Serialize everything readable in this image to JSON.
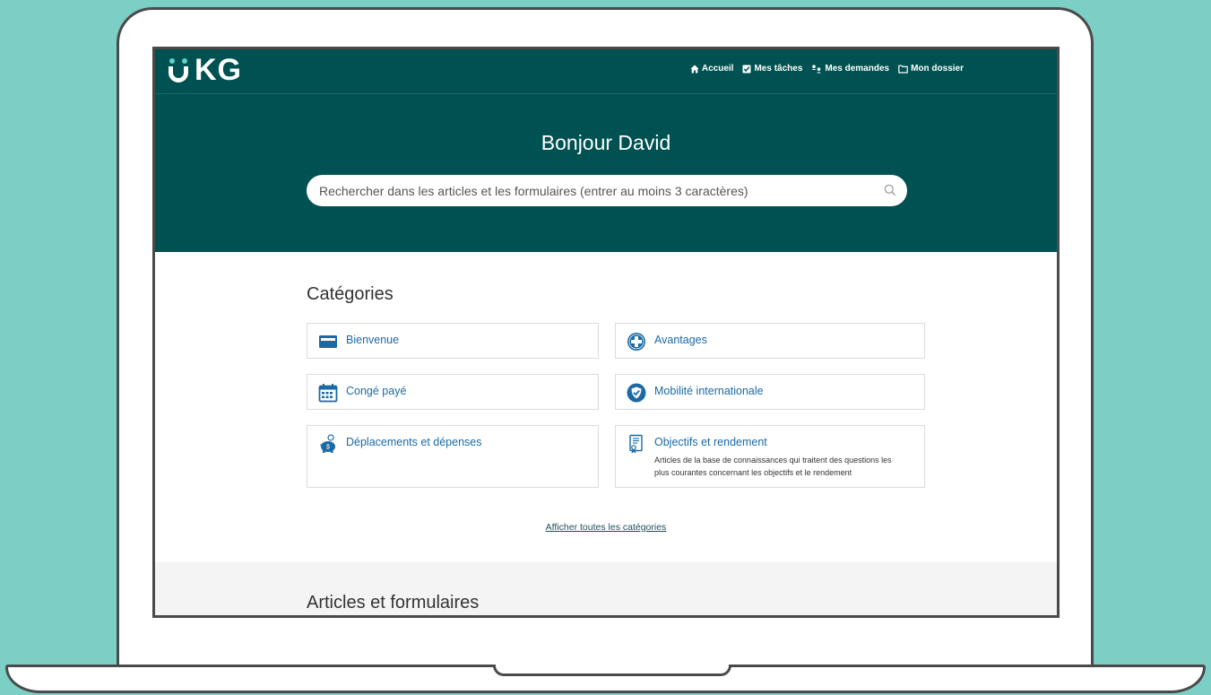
{
  "brand": {
    "logo_text": "KG",
    "accent_color": "#005151",
    "logo_dot_color": "#5ed4c6",
    "link_color": "#1b6aa5"
  },
  "nav": {
    "items": [
      {
        "label": "Accueil",
        "icon": "home-icon"
      },
      {
        "label": "Mes tâches",
        "icon": "checkbox-icon"
      },
      {
        "label": "Mes demandes",
        "icon": "requests-icon"
      },
      {
        "label": "Mon dossier",
        "icon": "folder-icon"
      }
    ]
  },
  "hero": {
    "greeting": "Bonjour David",
    "search_placeholder": "Rechercher dans les articles et les formulaires (entrer au moins 3 caractères)"
  },
  "categories": {
    "title": "Catégories",
    "items": [
      {
        "label": "Bienvenue",
        "icon": "card-icon",
        "description": ""
      },
      {
        "label": "Avantages",
        "icon": "medical-cross-icon",
        "description": ""
      },
      {
        "label": "Congé payé",
        "icon": "calendar-icon",
        "description": ""
      },
      {
        "label": "Mobilité internationale",
        "icon": "shield-check-icon",
        "description": ""
      },
      {
        "label": "Déplacements et dépenses",
        "icon": "piggy-bank-icon",
        "description": ""
      },
      {
        "label": "Objectifs et rendement",
        "icon": "certificate-icon",
        "description": "Articles de la base de connaissances qui traitent des questions les plus courantes concernant les objectifs et le rendement"
      }
    ],
    "view_all_label": "Afficher toutes les catégories"
  },
  "articles": {
    "title": "Articles et formulaires"
  }
}
